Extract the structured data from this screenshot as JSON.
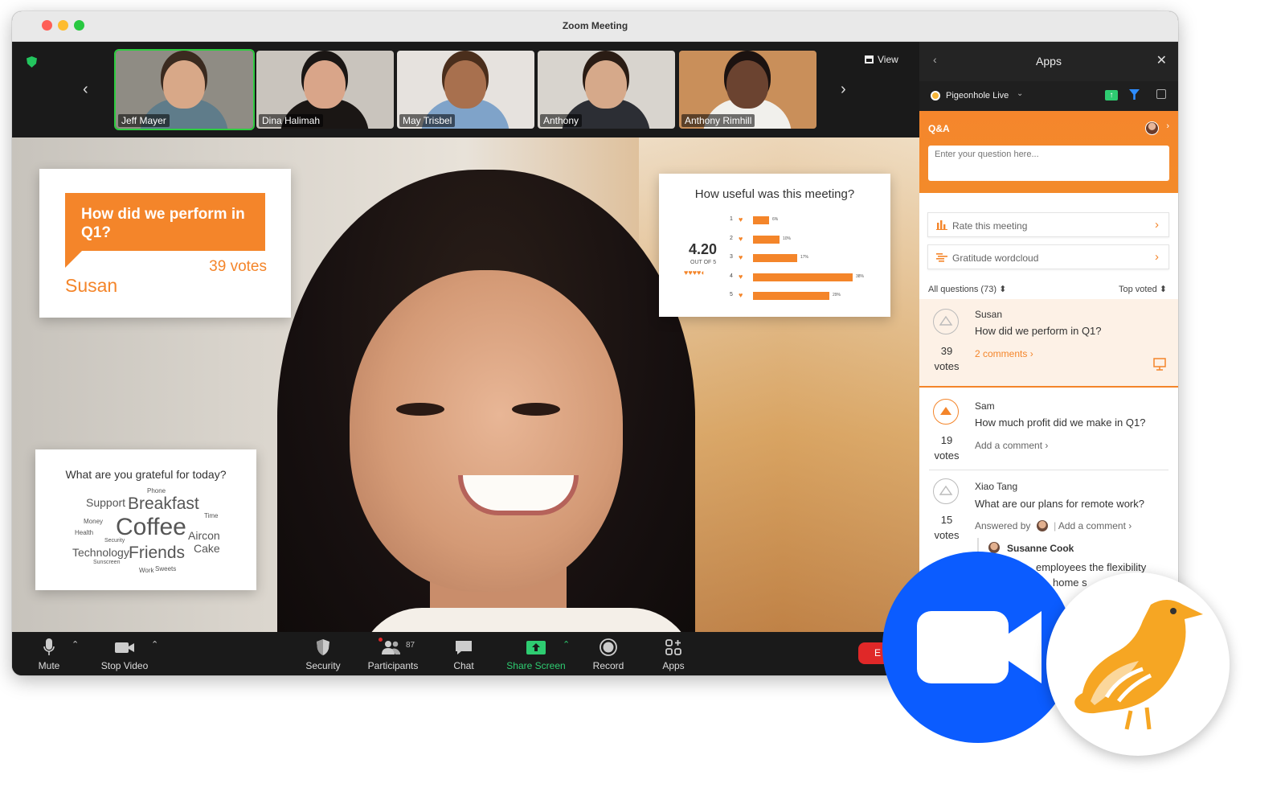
{
  "window": {
    "title": "Zoom Meeting"
  },
  "filmstrip": {
    "view_label": "View",
    "participants": [
      {
        "name": "Jeff Mayer",
        "active": true,
        "skin": "#d8a888",
        "hair": "#3a2a1f",
        "shirt": "#5f7c8a",
        "bg": "#8f8c84"
      },
      {
        "name": "Dina Halimah",
        "active": false,
        "skin": "#d9a589",
        "hair": "#1a1614",
        "shirt": "#1a1614",
        "bg": "#c9c4bd"
      },
      {
        "name": "May Trisbel",
        "active": false,
        "skin": "#a8704e",
        "hair": "#4a2e1c",
        "shirt": "#7fa3c9",
        "bg": "#e6e2de"
      },
      {
        "name": "Anthony",
        "active": false,
        "skin": "#d6a98a",
        "hair": "#2a1c14",
        "shirt": "#2c2e34",
        "bg": "#d8d4ce"
      },
      {
        "name": "Anthony Rimhill",
        "active": false,
        "skin": "#6b4330",
        "hair": "#1b1210",
        "shirt": "#f1f0ec",
        "bg": "#c98f5a"
      }
    ]
  },
  "question_card": {
    "question": "How did we perform in Q1?",
    "votes": "39 votes",
    "author": "Susan"
  },
  "rating_card": {
    "title": "How useful was this meeting?",
    "score": "4.20",
    "out_of": "OUT OF 5",
    "hearts": "♥♥♥♥◐",
    "rows": [
      {
        "label": "1",
        "percent": 6,
        "pct_label": "6%"
      },
      {
        "label": "2",
        "percent": 10,
        "pct_label": "10%"
      },
      {
        "label": "3",
        "percent": 17,
        "pct_label": "17%"
      },
      {
        "label": "4",
        "percent": 38,
        "pct_label": "38%"
      },
      {
        "label": "5",
        "percent": 29,
        "pct_label": "29%"
      }
    ]
  },
  "wordcloud_card": {
    "title": "What are you grateful for today?",
    "words": {
      "phone": "Phone",
      "support": "Support",
      "breakfast": "Breakfast",
      "time": "Time",
      "money": "Money",
      "health": "Health",
      "coffee": "Coffee",
      "aircon": "Aircon",
      "security": "Security",
      "technology": "Technology",
      "friends": "Friends",
      "cake": "Cake",
      "sunscreen": "Sunscreen",
      "work": "Work",
      "sweets": "Sweets"
    }
  },
  "toolbar": {
    "mute": "Mute",
    "stop_video": "Stop Video",
    "security": "Security",
    "participants": "Participants",
    "participants_count": "87",
    "chat": "Chat",
    "share_screen": "Share Screen",
    "record": "Record",
    "apps": "Apps",
    "end": "E"
  },
  "panel": {
    "title": "Apps",
    "app_name": "Pigeonhole Live",
    "qa_label": "Q&A",
    "input_placeholder": "Enter your question here...",
    "menu": [
      {
        "label": "Rate this meeting",
        "icon": "bar-chart-icon"
      },
      {
        "label": "Gratitude wordcloud",
        "icon": "wordcloud-icon"
      }
    ],
    "filter_left": "All questions (73)",
    "filter_right": "Top voted",
    "questions": [
      {
        "author": "Susan",
        "text": "How did we perform in Q1?",
        "votes": "39",
        "votes_label": "votes",
        "link": "2 comments",
        "highlighted": true
      },
      {
        "author": "Sam",
        "text": "How much profit did we make in Q1?",
        "votes": "19",
        "votes_label": "votes",
        "link": "Add a comment",
        "highlighted": false
      },
      {
        "author": "Xiao Tang",
        "text": "What are our plans for remote work?",
        "votes": "15",
        "votes_label": "votes",
        "answered_by": "Answered by",
        "link": "Add a comment",
        "highlighted": false
      }
    ],
    "answer": {
      "author": "Susanne Cook",
      "text": "employees the flexibility",
      "text2": "home s"
    }
  },
  "colors": {
    "accent": "#f4852a",
    "zoom_blue": "#0b5cff",
    "share_green": "#2ecc71"
  }
}
